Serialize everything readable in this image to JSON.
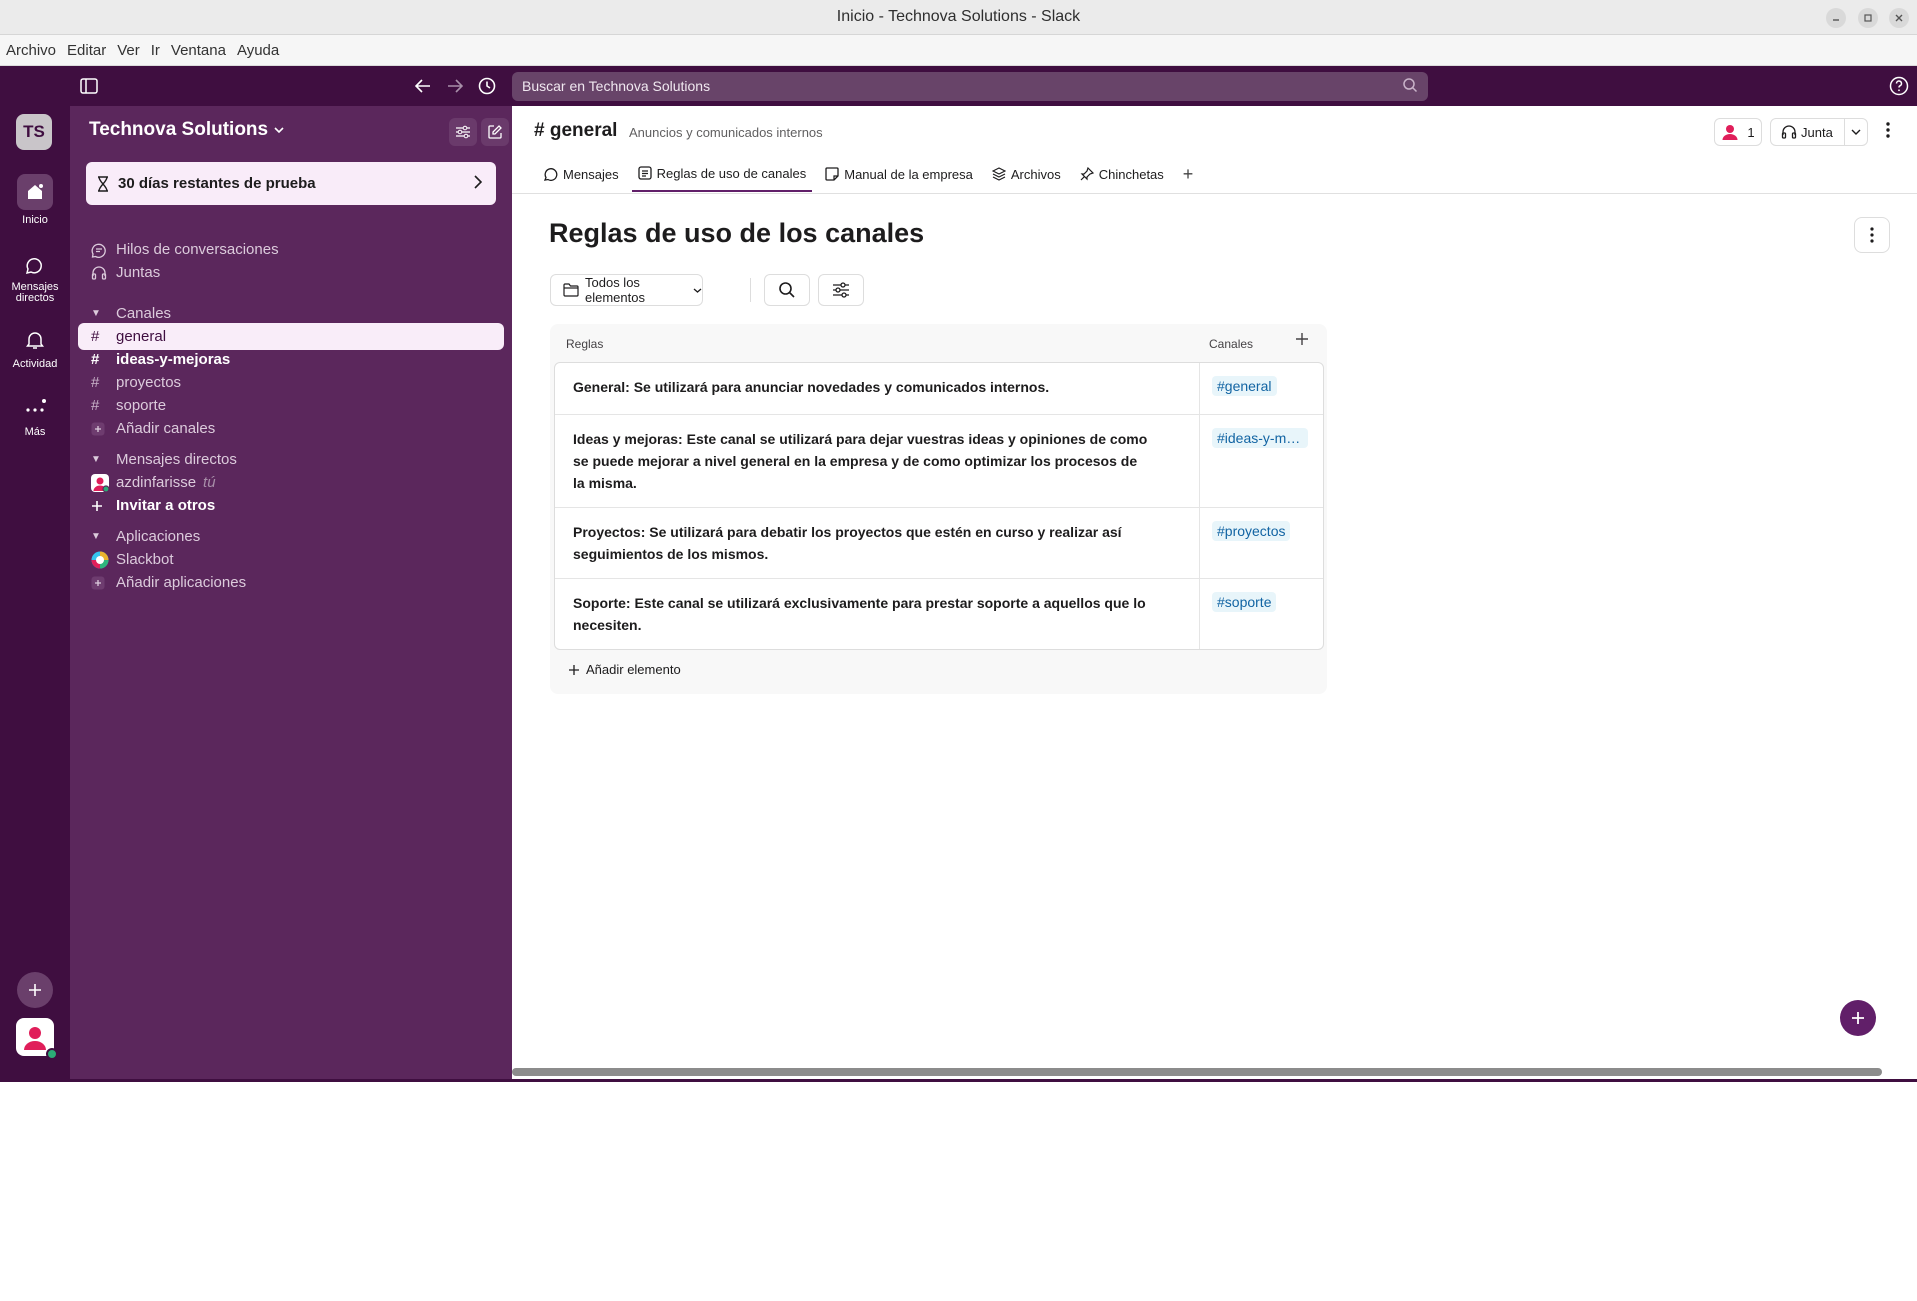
{
  "window": {
    "title": "Inicio - Technova Solutions - Slack"
  },
  "menubar": {
    "items": [
      "Archivo",
      "Editar",
      "Ver",
      "Ir",
      "Ventana",
      "Ayuda"
    ]
  },
  "topbar": {
    "search_placeholder": "Buscar en Technova Solutions"
  },
  "rail": {
    "workspace_initials": "TS",
    "items": [
      {
        "label": "Inicio",
        "icon": "home-icon"
      },
      {
        "label": "Mensajes directos",
        "icon": "dm-icon"
      },
      {
        "label": "Actividad",
        "icon": "bell-icon"
      },
      {
        "label": "Más",
        "icon": "more-icon"
      }
    ]
  },
  "sidebar": {
    "workspace_name": "Technova Solutions",
    "trial_banner": "30 días restantes de prueba",
    "nav": [
      {
        "label": "Hilos de conversaciones",
        "icon": "threads-icon"
      },
      {
        "label": "Juntas",
        "icon": "headphones-icon"
      }
    ],
    "channels_header": "Canales",
    "channels": [
      {
        "name": "general",
        "active": true,
        "unread": false
      },
      {
        "name": "ideas-y-mejoras",
        "active": false,
        "unread": true
      },
      {
        "name": "proyectos",
        "active": false,
        "unread": false
      },
      {
        "name": "soporte",
        "active": false,
        "unread": false
      }
    ],
    "add_channels": "Añadir canales",
    "dm_header": "Mensajes directos",
    "dm_user": "azdinfarisse",
    "dm_you": "tú",
    "invite": "Invitar a otros",
    "apps_header": "Aplicaciones",
    "apps": [
      "Slackbot"
    ],
    "add_apps": "Añadir aplicaciones"
  },
  "channel": {
    "name": "# general",
    "description": "Anuncios y comunicados internos",
    "member_count": "1",
    "huddle_label": "Junta",
    "tabs": [
      {
        "label": "Mensajes",
        "icon": "message-icon"
      },
      {
        "label": "Reglas de uso de canales",
        "icon": "list-icon",
        "active": true
      },
      {
        "label": "Manual de la empresa",
        "icon": "canvas-icon"
      },
      {
        "label": "Archivos",
        "icon": "files-icon"
      },
      {
        "label": "Chinchetas",
        "icon": "pin-icon"
      }
    ]
  },
  "list": {
    "title": "Reglas de uso de los canales",
    "filter_label": "Todos los elementos",
    "col_rules": "Reglas",
    "col_channels": "Canales",
    "rows": [
      {
        "rule": "General: Se utilizará para anunciar novedades y comunicados internos.",
        "channel": "#general"
      },
      {
        "rule": "Ideas y mejoras: Este canal se utilizará para dejar vuestras ideas y opiniones de como se puede mejorar a nivel general en la empresa y de como optimizar los procesos de la misma.",
        "channel": "#ideas-y-mejoras"
      },
      {
        "rule": "Proyectos: Se utilizará para debatir los proyectos que estén en curso y realizar así seguimientos de los mismos.",
        "channel": "#proyectos"
      },
      {
        "rule": "Soporte: Este canal se utilizará exclusivamente para prestar soporte a aquellos que lo necesiten.",
        "channel": "#soporte"
      }
    ],
    "add_item": "Añadir elemento"
  },
  "colors": {
    "aubergine": "#3f0e40",
    "sidebar": "#5b275c",
    "active_item": "#f9edf9",
    "link": "#1264a3",
    "accent": "#611f69",
    "presence": "#2bac76"
  }
}
